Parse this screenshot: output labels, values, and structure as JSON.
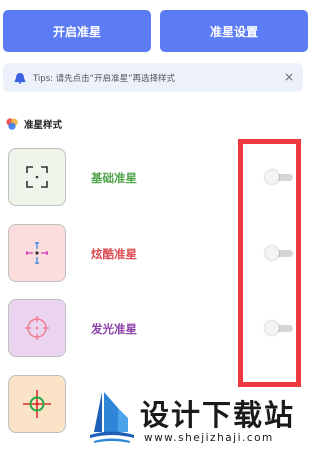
{
  "header": {
    "start_button": "开启准星",
    "settings_button": "准星设置"
  },
  "tips": {
    "text": "Tips: 请先点击“开启准星”再选择样式",
    "close": "×"
  },
  "section": {
    "title": "准星样式"
  },
  "styles": [
    {
      "label": "基础准星",
      "color": "#53a54f",
      "bg": "#eef5ea",
      "enabled": false
    },
    {
      "label": "炫酷准星",
      "color": "#dc4c52",
      "bg": "#fbdddd",
      "enabled": false
    },
    {
      "label": "发光准星",
      "color": "#8e43aa",
      "bg": "#ead4ef",
      "enabled": false
    },
    {
      "bg": "#fbe3c8"
    }
  ],
  "watermark": {
    "title": "设计下载站",
    "url": "www.shejizhaji.com"
  },
  "colors": {
    "primary": "#5b7cf4",
    "highlight": "#ee3a3f"
  }
}
